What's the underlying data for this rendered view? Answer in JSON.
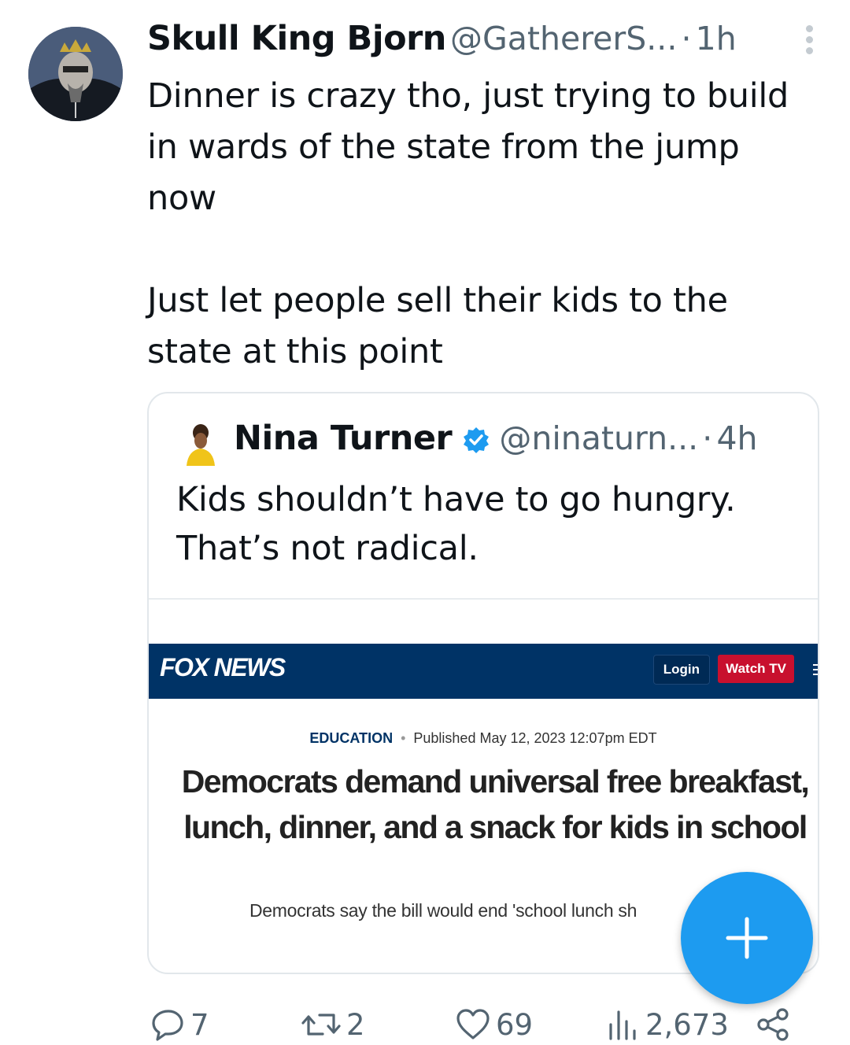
{
  "tweet": {
    "author_name": "Skull King Bjorn",
    "author_handle": "@GathererS...",
    "separator": "·",
    "time": "1h",
    "text": "Dinner is crazy tho, just trying to build\nin wards of the state from the jump\nnow\n\nJust let people sell their kids to the\nstate at this point"
  },
  "quoted_tweet": {
    "author_name": "Nina Turner",
    "author_handle": "@ninaturn...",
    "separator": "·",
    "time": "4h",
    "text": "Kids shouldn’t have to go hungry.\nThat’s not radical."
  },
  "article": {
    "site_logo": "FOX NEWS",
    "login_label": "Login",
    "watch_label": "Watch TV",
    "category": "EDUCATION",
    "published": "Published May 12, 2023 12:07pm EDT",
    "headline": "Democrats demand universal free breakfast, lunch, dinner, and a snack for kids in school",
    "subhead": "Democrats say the bill would end 'school lunch sh"
  },
  "actions": {
    "reply_count": "7",
    "retweet_count": "2",
    "like_count": "69",
    "views_count": "2,673"
  },
  "colors": {
    "accent": "#1d9bf0",
    "fox_navy": "#003366",
    "fox_red": "#c8102e",
    "muted_text": "#536471"
  },
  "icons": [
    "more-icon",
    "verified-badge-icon",
    "reply-icon",
    "retweet-icon",
    "like-icon",
    "views-icon",
    "share-icon",
    "compose-plus-icon"
  ]
}
